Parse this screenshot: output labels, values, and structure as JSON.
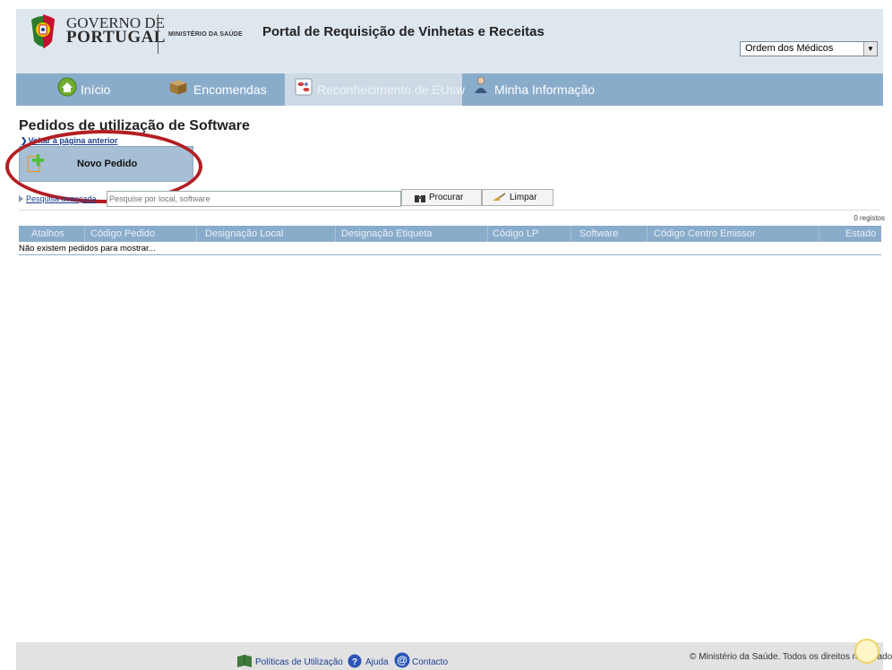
{
  "header": {
    "logo_line1": "GOVERNO DE",
    "logo_line2": "PORTUGAL",
    "ministry": "MINISTÉRIO DA SAÚDE",
    "portal_title": "Portal de Requisição de Vinhetas e Receitas",
    "org_select": {
      "value": "Ordem dos Médicos"
    }
  },
  "nav": {
    "items": [
      {
        "label": "Início",
        "icon": "home-icon"
      },
      {
        "label": "Encomendas",
        "icon": "package-icon"
      },
      {
        "label": "Reconhecimento de EUsw",
        "icon": "pills-icon",
        "active": true
      },
      {
        "label": "Minha Informação",
        "icon": "user-icon"
      }
    ]
  },
  "main": {
    "heading": "Pedidos de utilização de Software",
    "back_link": "Voltar à página anterior",
    "new_request": "Novo Pedido",
    "advanced_search": "Pesquisa avançada",
    "search_placeholder": "Pesquise por local, software",
    "search_button": "Procurar",
    "clear_button": "Limpar",
    "record_count": "0 registos",
    "table": {
      "columns": [
        "Atalhos",
        "Código Pedido",
        "Designação Local",
        "Designação Etiqueta",
        "Código LP",
        "Software",
        "Código Centro Emissor",
        "Estado"
      ],
      "empty_message": "Não existem pedidos para mostrar..."
    }
  },
  "footer": {
    "policies": "Políticas de Utilização",
    "help": "Ajuda",
    "contact": "Contacto",
    "copyright": "© Ministério da Saúde. Todos os direitos reservados"
  },
  "colors": {
    "nav_bg": "#8aaccb",
    "header_bg": "#dfe7ee",
    "highlight": "#b31e22"
  }
}
